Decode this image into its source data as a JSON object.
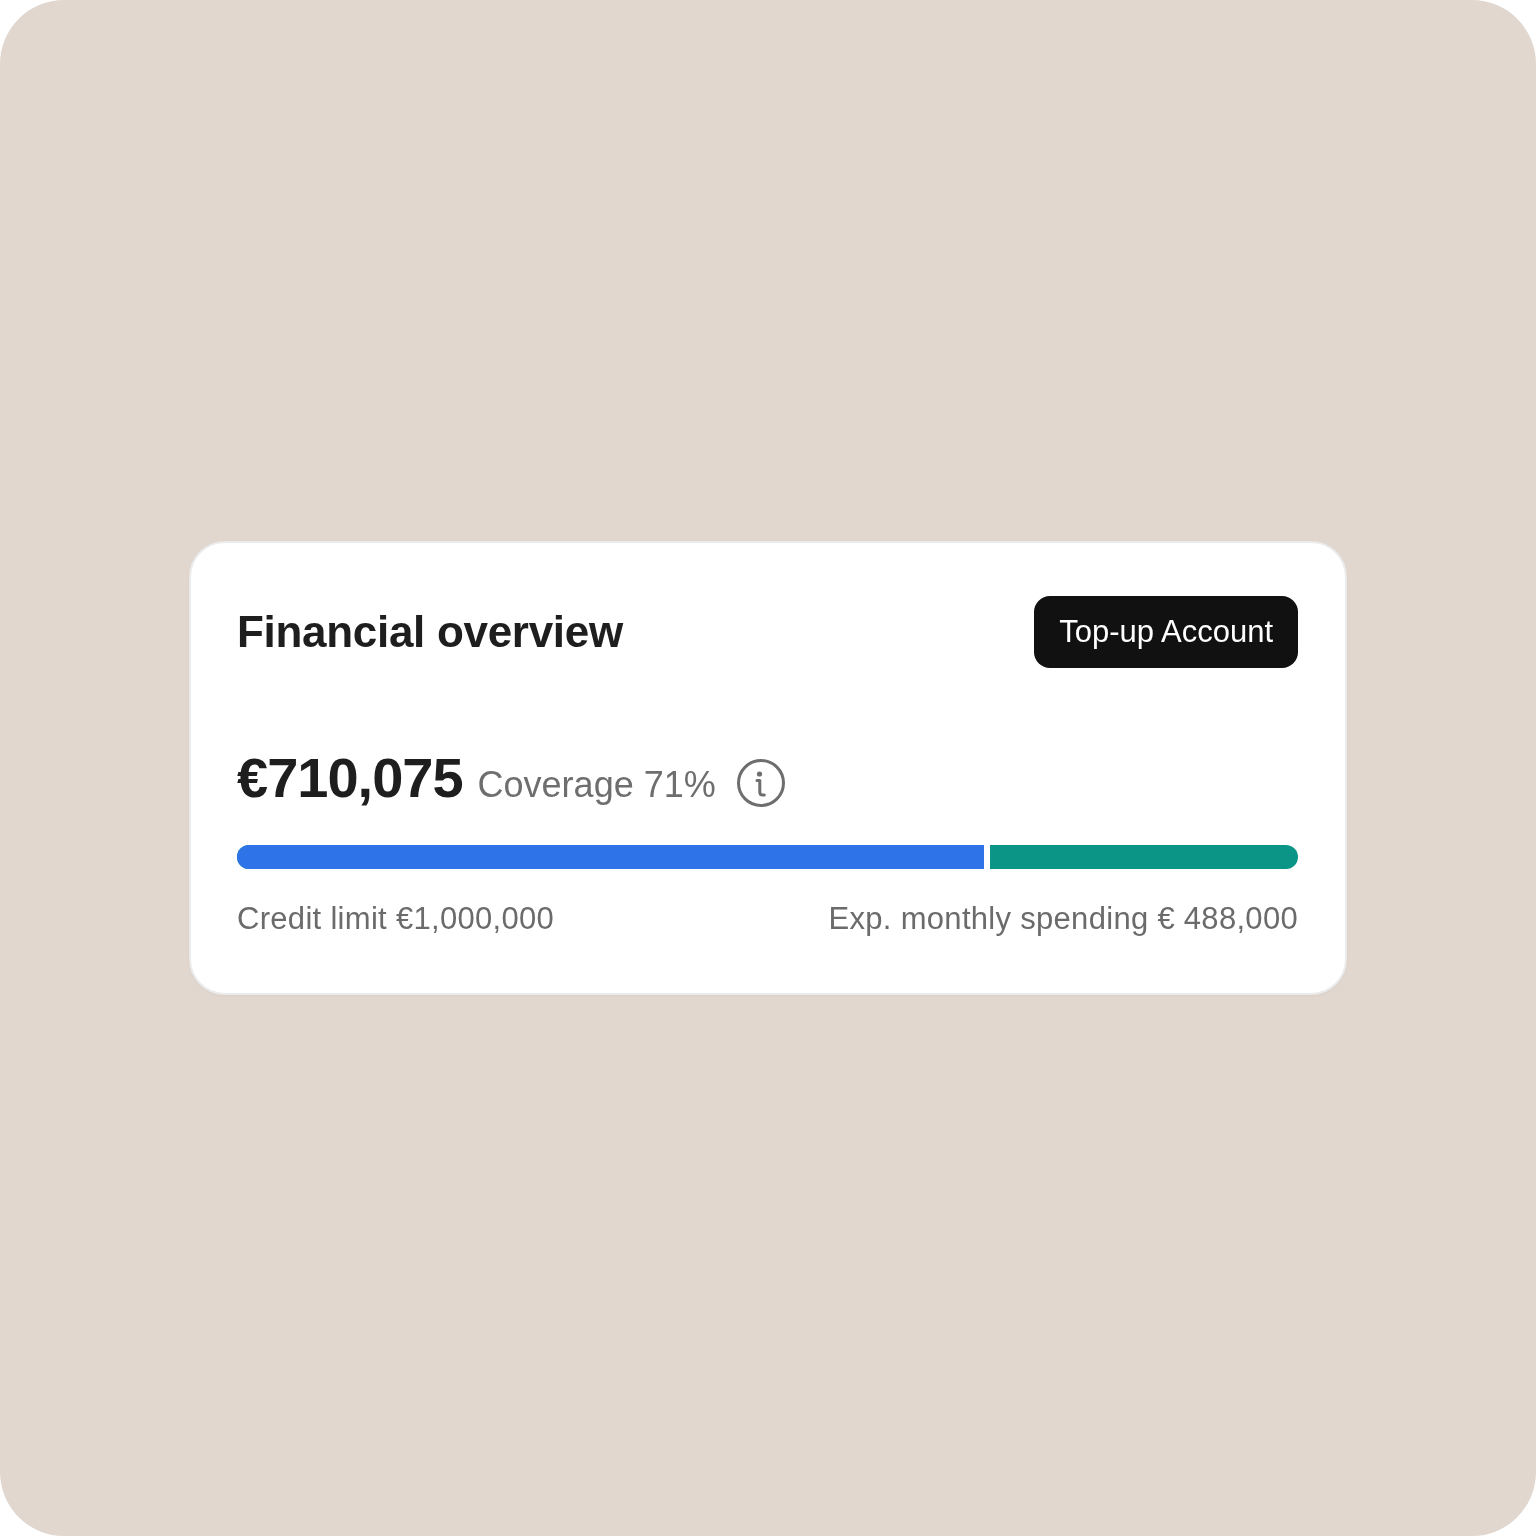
{
  "card": {
    "title": "Financial overview",
    "action_button": {
      "label": "Top-up Account"
    },
    "balance": "€710,075",
    "coverage": "Coverage 71%",
    "coverage_bar": {
      "level": 0.71
    },
    "credit_limit": "Credit limit €1,000,000",
    "monthly_spending": "Exp. monthly spending € 488,000"
  }
}
